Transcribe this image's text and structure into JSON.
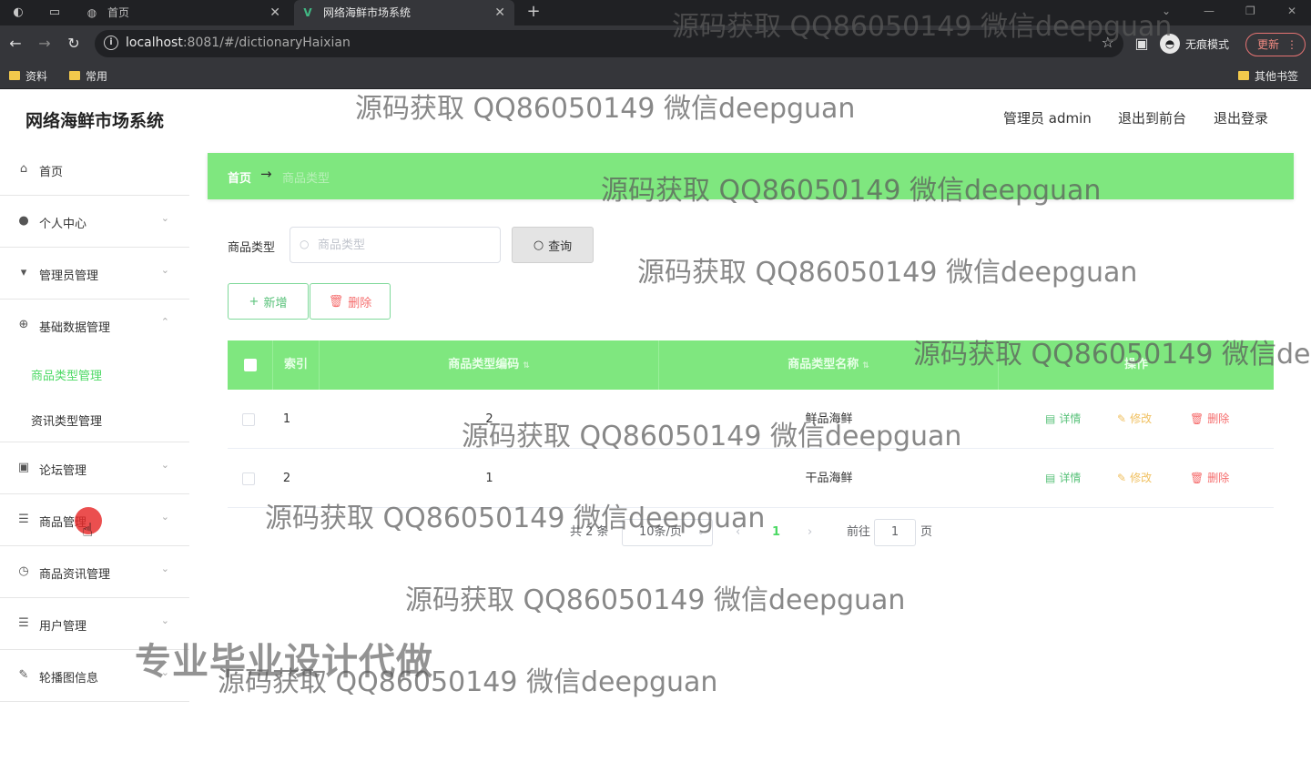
{
  "browser": {
    "tabs": [
      {
        "title": "首页",
        "active": false
      },
      {
        "title": "网络海鲜市场系统",
        "active": true
      }
    ],
    "url_host": "localhost",
    "url_rest": ":8081/#/dictionaryHaixian",
    "incognito_label": "无痕模式",
    "update_label": "更新",
    "bookmarks": [
      "资料",
      "常用"
    ],
    "other_bookmarks": "其他书签"
  },
  "header": {
    "title": "网络海鲜市场系统",
    "user": "管理员 admin",
    "to_front": "退出到前台",
    "logout": "退出登录"
  },
  "sidebar": {
    "items": [
      {
        "label": "首页",
        "icon": "home-icon"
      },
      {
        "label": "个人中心",
        "icon": "user-icon"
      },
      {
        "label": "管理员管理",
        "icon": "admin-icon"
      },
      {
        "label": "基础数据管理",
        "icon": "settings-icon"
      },
      {
        "label": "论坛管理",
        "icon": "forum-icon"
      },
      {
        "label": "商品管理",
        "icon": "list-icon"
      },
      {
        "label": "商品资讯管理",
        "icon": "clock-icon"
      },
      {
        "label": "用户管理",
        "icon": "list-icon"
      },
      {
        "label": "轮播图信息",
        "icon": "image-icon"
      }
    ],
    "sub_items": [
      {
        "label": "商品类型管理",
        "active": true
      },
      {
        "label": "资讯类型管理",
        "active": false
      }
    ]
  },
  "breadcrumb": {
    "home": "首页",
    "arrow": "→",
    "current": "商品类型"
  },
  "search": {
    "label": "商品类型",
    "placeholder": "商品类型",
    "button": "查询"
  },
  "actions": {
    "add": "新增",
    "delete": "删除"
  },
  "table": {
    "columns": [
      "索引",
      "商品类型编码",
      "商品类型名称",
      "操作"
    ],
    "rows": [
      {
        "index": "1",
        "code": "2",
        "name": "鲜品海鲜"
      },
      {
        "index": "2",
        "code": "1",
        "name": "干品海鲜"
      }
    ],
    "ops": {
      "detail": "详情",
      "edit": "修改",
      "remove": "删除"
    }
  },
  "pagination": {
    "total": "共 2 条",
    "page_size": "10条/页",
    "current_page": "1",
    "goto_prefix": "前往",
    "goto_value": "1",
    "goto_suffix": "页"
  },
  "watermarks": {
    "text": "源码获取 QQ86050149 微信deepguan",
    "ad": "专业毕业设计代做"
  }
}
